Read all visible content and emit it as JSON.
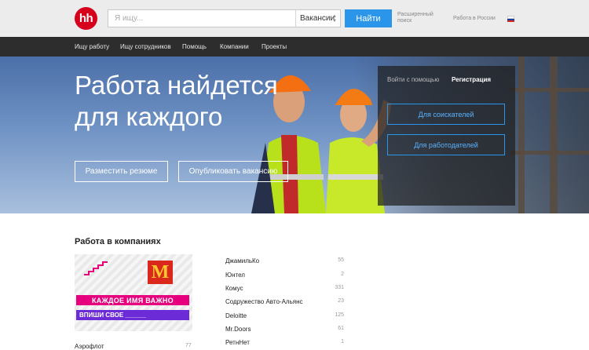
{
  "header": {
    "logo": "hh",
    "search_placeholder": "Я ищу...",
    "search_value": "",
    "search_type": "Вакансии",
    "find_button": "Найти",
    "advanced_line1": "Расширенный",
    "advanced_line2": "поиск",
    "region": "Работа в России",
    "flag_colors": [
      "#ffffff",
      "#1c3fa0",
      "#d52b1e"
    ]
  },
  "nav": {
    "items": [
      "Ищу работу",
      "Ищу сотрудников",
      "Помощь",
      "Компании",
      "Проекты"
    ]
  },
  "hero": {
    "title_line1": "Работа найдется",
    "title_line2": "для каждого",
    "post_resume": "Разместить резюме",
    "post_vacancy": "Опубликовать вакансию",
    "login_tab": "Войти с помощью",
    "register_tab": "Регистрация",
    "seekers_button": "Для соискателей",
    "employers_button": "Для работодателей"
  },
  "companies": {
    "title": "Работа в компаниях",
    "banner_line1": "КАЖДОЕ ИМЯ ВАЖНО",
    "banner_line2": "ВПИШИ СВОЕ ______",
    "banner_logo": "M",
    "list": [
      {
        "name": "ДжамильКо",
        "count": "55"
      },
      {
        "name": "Юнтел",
        "count": "2"
      },
      {
        "name": "Комус",
        "count": "331"
      },
      {
        "name": "Содружество Авто-Альянс",
        "count": "23"
      },
      {
        "name": "Deloitte",
        "count": "125"
      },
      {
        "name": "Mr.Doors",
        "count": "61"
      },
      {
        "name": "РетнНет",
        "count": "1"
      }
    ],
    "below_banner_name": "Аэрофлот",
    "below_banner_count": "77"
  }
}
